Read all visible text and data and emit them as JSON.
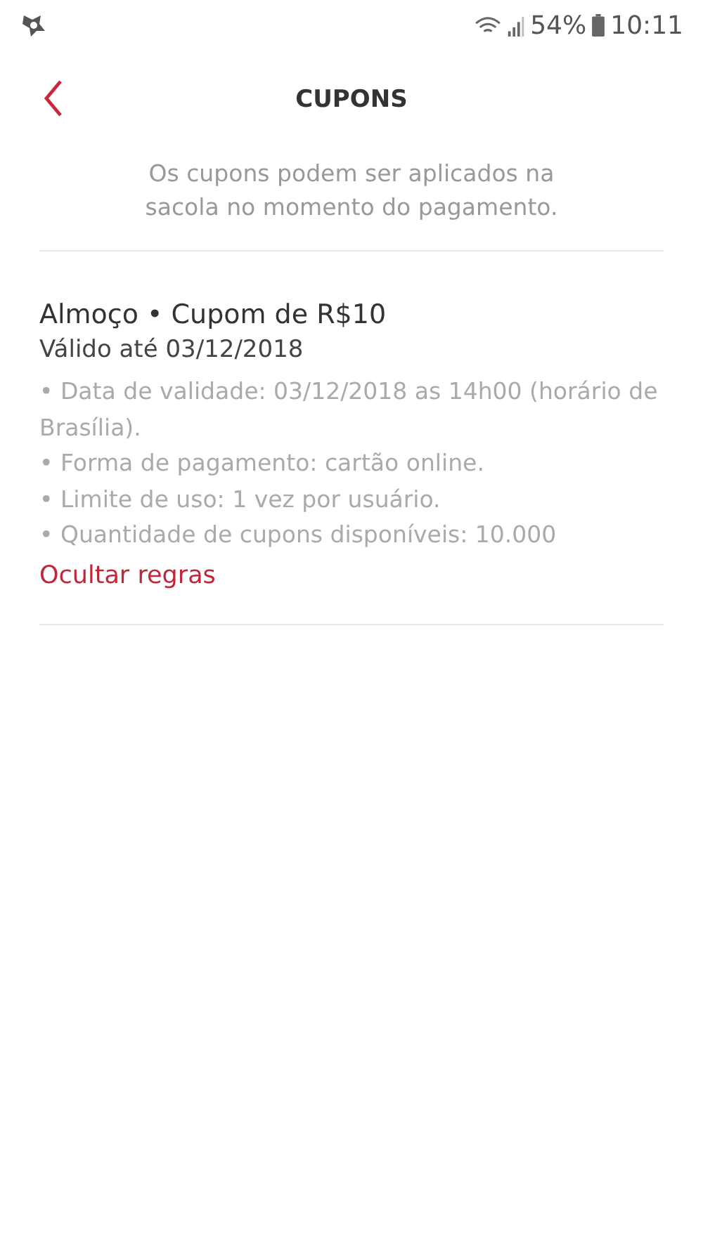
{
  "status_bar": {
    "battery": "54%",
    "time": "10:11"
  },
  "header": {
    "title": "CUPONS"
  },
  "intro": "Os cupons podem ser aplicados na sacola no momento do pagamento.",
  "coupons": [
    {
      "title": "Almoço • Cupom de R$10",
      "validity": "Válido até 03/12/2018",
      "rules_expanded": true,
      "rules": [
        "• Data de validade: 03/12/2018 as 14h00 (horário de Brasília).",
        "• Forma de pagamento: cartão online.",
        "• Limite de uso: 1 vez por usuário.",
        "• Quantidade de cupons disponíveis: 10.000"
      ],
      "toggle_label": "Ocultar regras"
    }
  ]
}
